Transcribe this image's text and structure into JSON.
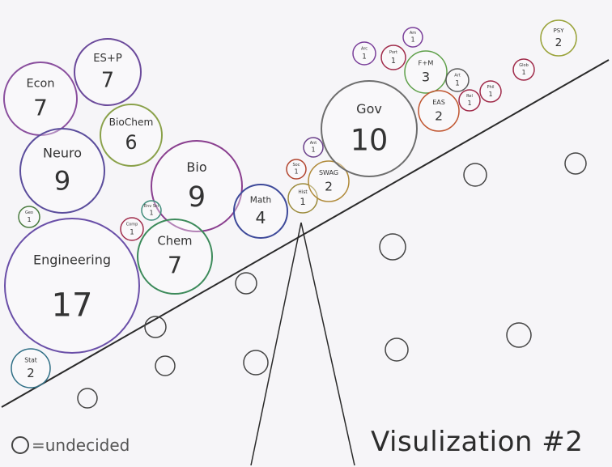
{
  "title": "Visulization #2",
  "legend_label": "=undecided",
  "majors": [
    {
      "label": "Econ",
      "count": "7",
      "color": "#8a4f9e"
    },
    {
      "label": "ES+P",
      "count": "7",
      "color": "#6b4a9b"
    },
    {
      "label": "BioChem",
      "count": "6",
      "color": "#8aa14a"
    },
    {
      "label": "Neuro",
      "count": "9",
      "color": "#5b4d9c"
    },
    {
      "label": "Bio",
      "count": "9",
      "color": "#8a3f8f"
    },
    {
      "label": "Geo",
      "count": "1",
      "color": "#4a7b3f"
    },
    {
      "label": "Engineering",
      "count": "17",
      "color": "#6a4fa8"
    },
    {
      "label": "Comp",
      "count": "1",
      "color": "#a02b4a"
    },
    {
      "label": "Env Sci",
      "count": "1",
      "color": "#3f8c7a"
    },
    {
      "label": "Chem",
      "count": "7",
      "color": "#3c8a5a"
    },
    {
      "label": "Stat",
      "count": "2",
      "color": "#2f6f86"
    },
    {
      "label": "Math",
      "count": "4",
      "color": "#3e4a9a"
    },
    {
      "label": "Hist",
      "count": "1",
      "color": "#9b8a3a"
    },
    {
      "label": "Soc",
      "count": "1",
      "color": "#b2452f"
    },
    {
      "label": "Ant",
      "count": "1",
      "color": "#6a3f8a"
    },
    {
      "label": "SWAG",
      "count": "2",
      "color": "#b08a3a"
    },
    {
      "label": "Gov",
      "count": "10",
      "color": "#6e6e6e"
    },
    {
      "label": "Arc",
      "count": "1",
      "color": "#7a3f9a"
    },
    {
      "label": "Port",
      "count": "1",
      "color": "#a02b4a"
    },
    {
      "label": "Am",
      "count": "1",
      "color": "#7a3f9a"
    },
    {
      "label": "F+M",
      "count": "3",
      "color": "#5fa04a"
    },
    {
      "label": "EAS",
      "count": "2",
      "color": "#c0552f"
    },
    {
      "label": "Art",
      "count": "1",
      "color": "#5a5a5a"
    },
    {
      "label": "Rel",
      "count": "1",
      "color": "#a02b4a"
    },
    {
      "label": "Phil",
      "count": "1",
      "color": "#a02b4a"
    },
    {
      "label": "Glob",
      "count": "1",
      "color": "#a02b4a"
    },
    {
      "label": "PSY",
      "count": "2",
      "color": "#9aa33a"
    }
  ]
}
